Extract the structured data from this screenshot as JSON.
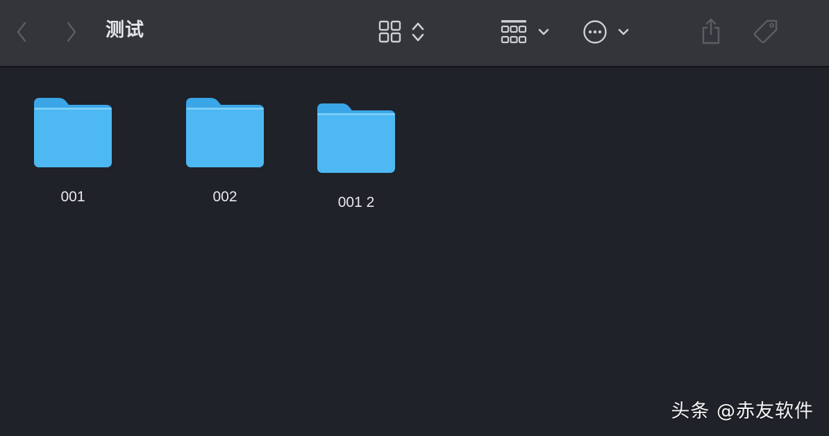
{
  "window": {
    "title": "测试"
  },
  "toolbar": {
    "back_icon": "chevron-left-icon",
    "forward_icon": "chevron-right-icon",
    "view_icon": "grid-view-icon",
    "group_icon": "group-by-icon",
    "more_icon": "ellipsis-circle-icon",
    "share_icon": "share-icon",
    "tag_icon": "tag-icon"
  },
  "folders": [
    {
      "name": "001"
    },
    {
      "name": "002"
    },
    {
      "name": "001 2"
    }
  ],
  "watermark": {
    "text": "头条 @赤友软件"
  },
  "colors": {
    "toolbar_bg": "#33353b",
    "content_bg": "#1f2229",
    "folder_blue": "#4db8f2",
    "folder_tab": "#3aa6e8",
    "icon": "#cfd0d4",
    "icon_disabled": "#5c5e64"
  }
}
